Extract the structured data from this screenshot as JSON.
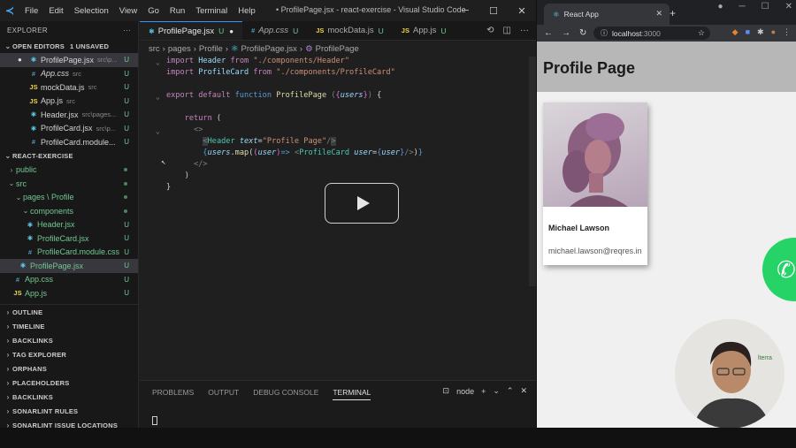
{
  "vscode": {
    "menu": [
      "File",
      "Edit",
      "Selection",
      "View",
      "Go",
      "Run",
      "Terminal",
      "Help"
    ],
    "window_title": "• ProfilePage.jsx - react-exercise - Visual Studio Code",
    "explorer_title": "EXPLORER",
    "open_editors_label": "OPEN EDITORS",
    "unsaved_label": "1 UNSAVED",
    "open_editors": [
      {
        "name": "ProfilePage.jsx",
        "path": "src\\p...",
        "status": "U",
        "kind": "jsx"
      },
      {
        "name": "App.css",
        "path": "src",
        "status": "U",
        "kind": "css"
      },
      {
        "name": "mockData.js",
        "path": "src",
        "status": "U",
        "kind": "js"
      },
      {
        "name": "App.js",
        "path": "src",
        "status": "U",
        "kind": "js"
      },
      {
        "name": "Header.jsx",
        "path": "src\\pages...",
        "status": "U",
        "kind": "jsx"
      },
      {
        "name": "ProfileCard.jsx",
        "path": "src\\p...",
        "status": "U",
        "kind": "jsx"
      },
      {
        "name": "ProfileCard.module...",
        "path": "",
        "status": "U",
        "kind": "css"
      }
    ],
    "project_label": "REACT-EXERCISE",
    "tree": [
      {
        "name": "public",
        "status": "•",
        "kind": "folder"
      },
      {
        "name": "src",
        "status": "•",
        "kind": "folder"
      },
      {
        "name": "pages \\ Profile",
        "status": "•",
        "kind": "folder"
      },
      {
        "name": "components",
        "status": "•",
        "kind": "folder"
      },
      {
        "name": "Header.jsx",
        "status": "U",
        "kind": "jsx"
      },
      {
        "name": "ProfileCard.jsx",
        "status": "U",
        "kind": "jsx"
      },
      {
        "name": "ProfileCard.module.css",
        "status": "U",
        "kind": "css"
      },
      {
        "name": "ProfilePage.jsx",
        "status": "U",
        "kind": "jsx"
      },
      {
        "name": "App.css",
        "status": "U",
        "kind": "css"
      },
      {
        "name": "App.js",
        "status": "U",
        "kind": "js"
      }
    ],
    "sections": [
      "OUTLINE",
      "TIMELINE",
      "BACKLINKS",
      "TAG EXPLORER",
      "ORPHANS",
      "PLACEHOLDERS",
      "BACKLINKS",
      "SONARLINT RULES",
      "SONARLINT ISSUE LOCATIONS"
    ],
    "tabs": [
      {
        "name": "ProfilePage.jsx",
        "status": "U",
        "dirty": "●",
        "kind": "jsx"
      },
      {
        "name": "App.css",
        "status": "U",
        "kind": "css"
      },
      {
        "name": "mockData.js",
        "status": "U",
        "kind": "js"
      },
      {
        "name": "App.js",
        "status": "U",
        "kind": "js"
      }
    ],
    "breadcrumb": [
      "src",
      "pages",
      "Profile",
      "ProfilePage.jsx",
      "ProfilePage"
    ],
    "panel_tabs": [
      "PROBLEMS",
      "OUTPUT",
      "DEBUG CONSOLE",
      "TERMINAL"
    ],
    "terminal_shell": "node"
  },
  "browser": {
    "tab_title": "React App",
    "url_host": "localhost",
    "url_port": ":3000",
    "page_title": "Profile Page",
    "profile": {
      "name": "Michael Lawson",
      "email": "michael.lawson@reqres.in"
    }
  }
}
